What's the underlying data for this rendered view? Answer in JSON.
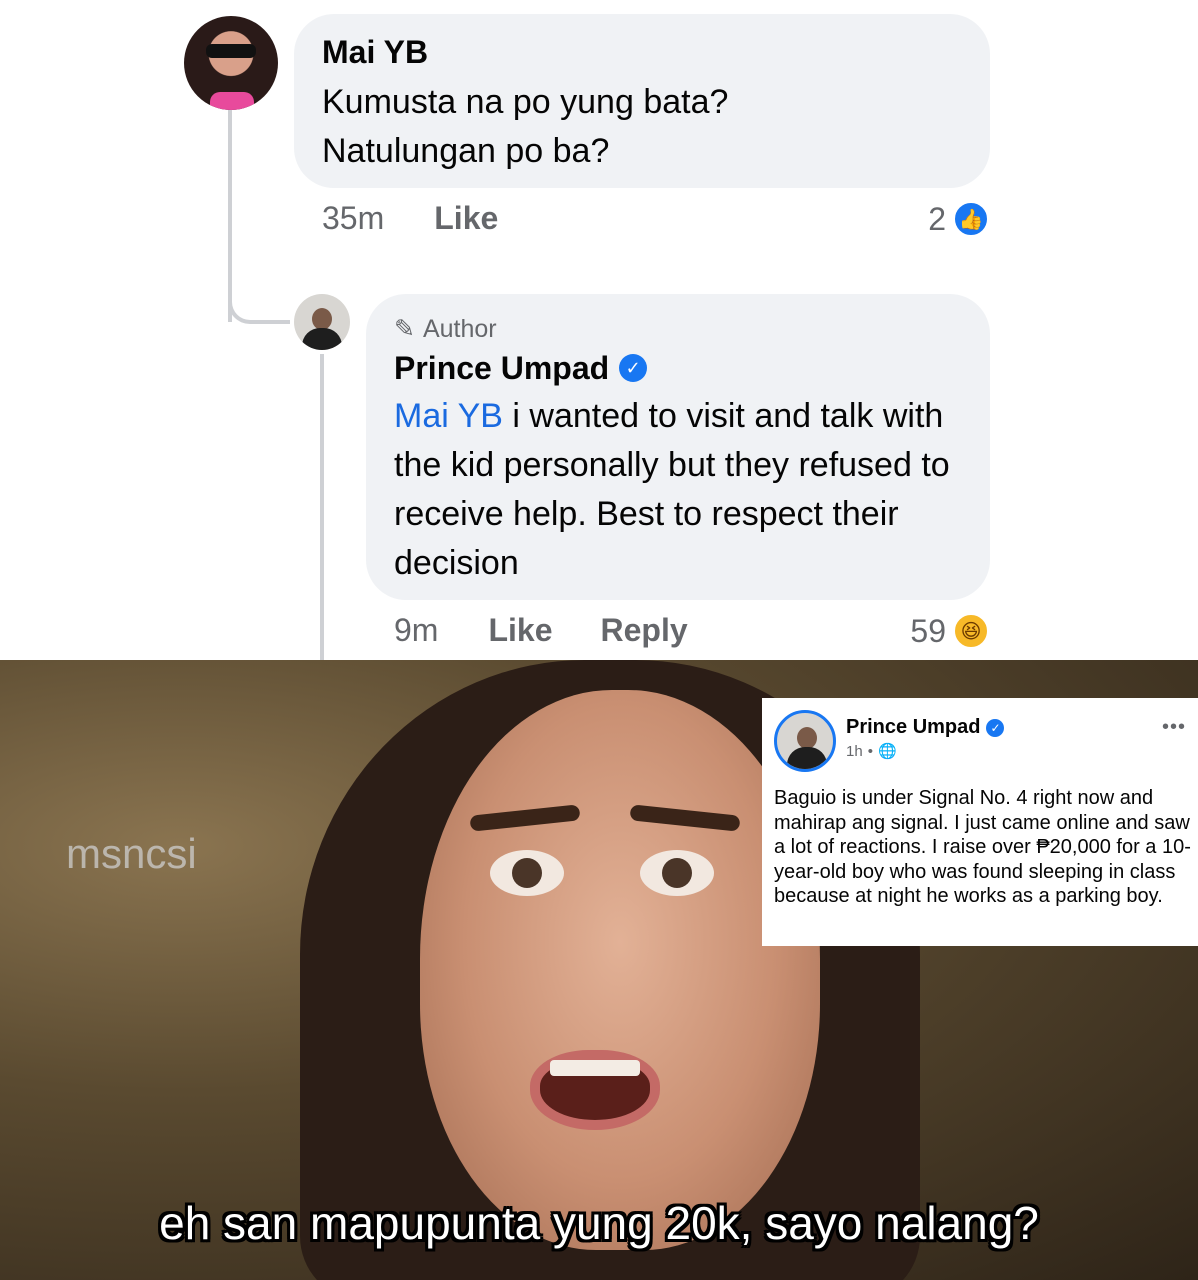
{
  "comment": {
    "name": "Mai YB",
    "text_line1": "Kumusta na po yung bata?",
    "text_line2": "Natulungan po ba?",
    "time": "35m",
    "like_label": "Like",
    "reaction_count": "2",
    "reaction_icon": "like-icon"
  },
  "reply": {
    "author_badge": "Author",
    "name": "Prince Umpad",
    "mention": "Mai YB",
    "text": " i wanted to visit and talk with the kid personally but they refused to receive help. Best to respect their decision",
    "time": "9m",
    "like_label": "Like",
    "reply_label": "Reply",
    "reaction_count": "59",
    "reaction_icon": "haha-icon"
  },
  "meme": {
    "watermark": "msncsi",
    "caption": "eh san mapupunta yung 20k, sayo nalang?"
  },
  "post": {
    "name": "Prince Umpad",
    "time": "1h",
    "more": "•••",
    "text": "Baguio is under Signal No. 4 right now and mahirap ang signal. I just came online and saw a lot of reactions. I raise over ₱20,000 for a 10-year-old boy who was found sleeping in class because at night he works as a parking boy."
  },
  "colors": {
    "facebook_blue": "#1877f2",
    "bubble_bg": "#f0f2f5",
    "meta_grey": "#65676b"
  }
}
